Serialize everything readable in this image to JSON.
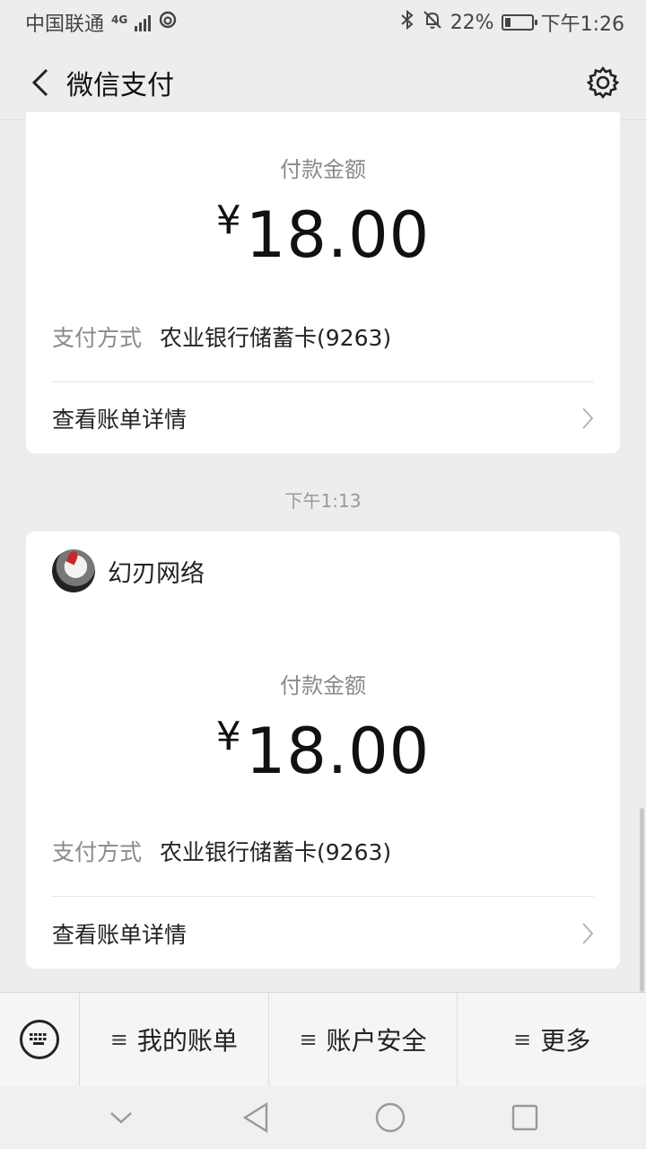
{
  "status": {
    "carrier": "中国联通",
    "network": "4G",
    "battery": "22%",
    "battery_level": 0.22,
    "time": "下午1:26"
  },
  "header": {
    "title": "微信支付"
  },
  "cards": [
    {
      "amount_label": "付款金额",
      "currency": "¥",
      "amount": "18.00",
      "pay_method_label": "支付方式",
      "pay_method_value": "农业银行储蓄卡(9263)",
      "detail_link": "查看账单详情"
    },
    {
      "merchant": "幻刃网络",
      "amount_label": "付款金额",
      "currency": "¥",
      "amount": "18.00",
      "pay_method_label": "支付方式",
      "pay_method_value": "农业银行储蓄卡(9263)",
      "detail_link": "查看账单详情"
    }
  ],
  "timestamp": "下午1:13",
  "menu": {
    "items": [
      {
        "label": "我的账单"
      },
      {
        "label": "账户安全"
      },
      {
        "label": "更多"
      }
    ]
  },
  "icons": {
    "back": "chevron-left-icon",
    "settings": "gear-icon",
    "keyboard": "keyboard-icon",
    "menu": "hamburger-icon"
  }
}
